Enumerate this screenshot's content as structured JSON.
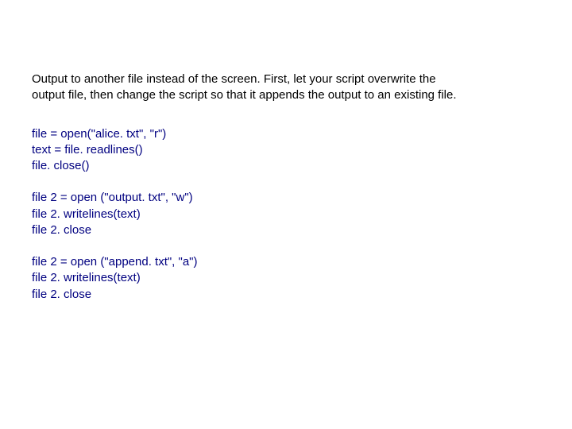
{
  "instruction": {
    "line1": "Output to another file instead of the screen. First, let your script overwrite the",
    "line2": "output file, then change the script so that it appends the output to an existing file."
  },
  "code": {
    "block1": {
      "l1": "file = open(\"alice. txt\", \"r\")",
      "l2": "text = file. readlines()",
      "l3": "file. close()"
    },
    "block2": {
      "l1": "file 2 = open (\"output. txt\", \"w\")",
      "l2": "file 2. writelines(text)",
      "l3": "file 2. close"
    },
    "block3": {
      "l1": "file 2 = open (\"append. txt\", \"a\")",
      "l2": "file 2. writelines(text)",
      "l3": "file 2. close"
    }
  }
}
